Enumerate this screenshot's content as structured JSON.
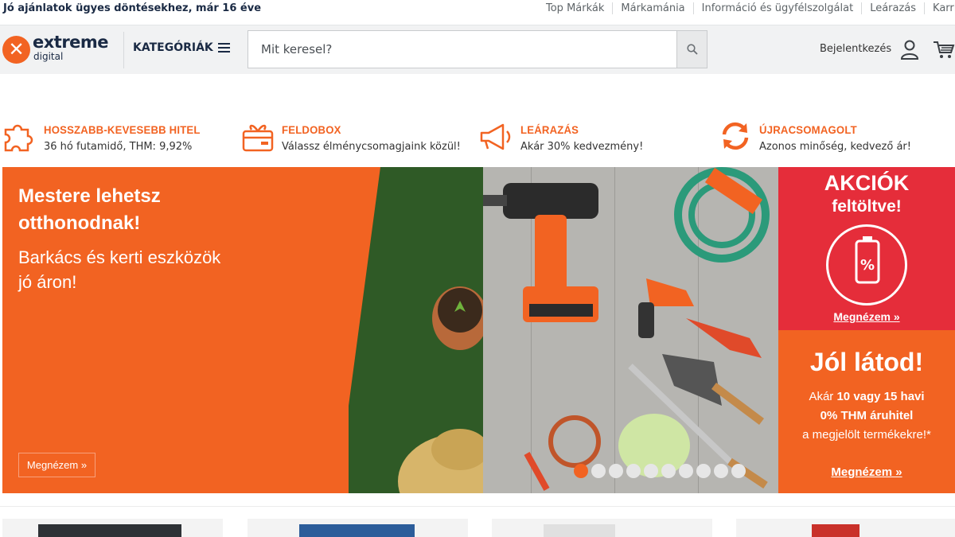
{
  "topbar": {
    "tagline": "Jó ajánlatok ügyes döntésekhez, már 16 éve",
    "links": [
      "Top Márkák",
      "Márkamánia",
      "Információ és ügyfélszolgálat",
      "Leárazás",
      "Karrier"
    ]
  },
  "header": {
    "logo_word1": "extreme",
    "logo_word2": "digital",
    "categories_label": "KATEGÓRIÁK",
    "search_placeholder": "Mit keresel?",
    "login_label": "Bejelentkezés"
  },
  "features": [
    {
      "title": "HOSSZABB-KEVESEBB HITEL",
      "subtitle": "36 hó futamidő, THM: 9,92%",
      "icon": "puzzle-icon"
    },
    {
      "title": "FELDOBOX",
      "subtitle": "Válassz élménycsomagjaink közül!",
      "icon": "gift-icon"
    },
    {
      "title": "LEÁRAZÁS",
      "subtitle": "Akár 30% kedvezmény!",
      "icon": "megaphone-icon"
    },
    {
      "title": "ÚJRACSOMAGOLT",
      "subtitle": "Azonos minőség, kedvező ár!",
      "icon": "refresh-icon"
    }
  ],
  "banner": {
    "headline_line1": "Mestere lehetsz",
    "headline_line2": "otthonodnak!",
    "subline_line1": "Barkács és kerti eszközök",
    "subline_line2": "jó áron!",
    "cta": "Megnézem »",
    "slide_count": 10,
    "active_slide": 1
  },
  "promo_red": {
    "title1": "AKCIÓK",
    "title2": "feltöltve!",
    "link": "Megnézem »"
  },
  "promo_orange": {
    "title": "Jól látod!",
    "text1_pre": "Akár ",
    "text1_bold": "10 vagy 15 havi",
    "text2_bold": "0% THM áruhitel",
    "text3": "a megjelölt termékekre!*",
    "link": "Megnézem »"
  },
  "colors": {
    "accent": "#f26322",
    "promo_red": "#e52d3a",
    "navy": "#1a2a44"
  }
}
